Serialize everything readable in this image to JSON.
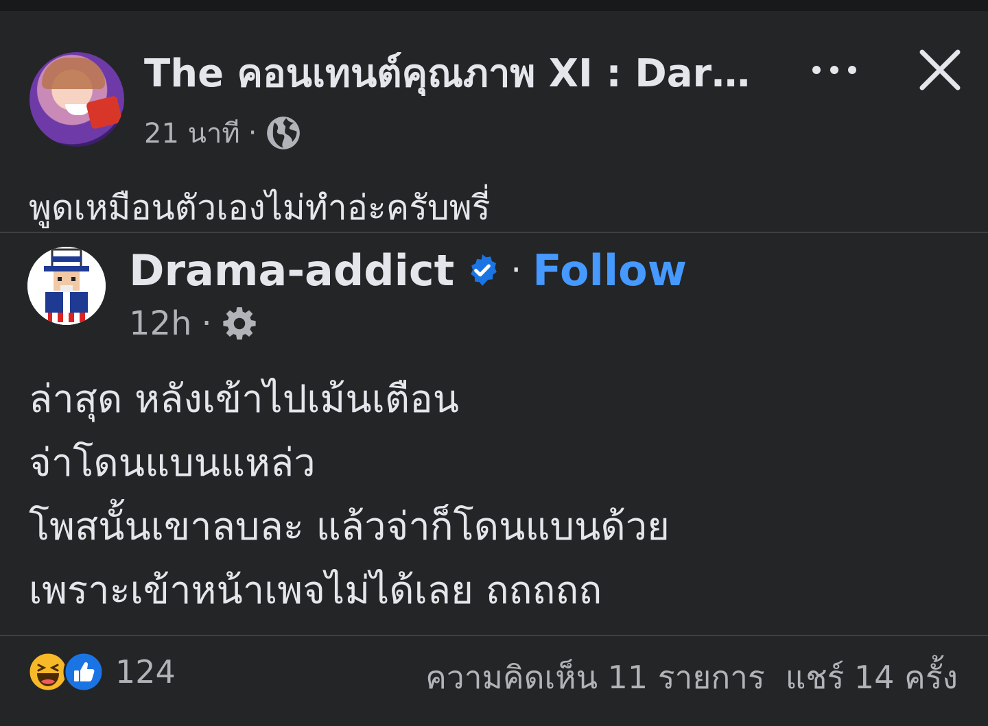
{
  "post": {
    "title": "The คอนเทนต์คุณภาพ XI : Dark ...",
    "time": "21 นาที",
    "separator": "·",
    "caption": "พูดเหมือนตัวเองไม่ทำอ่ะครับพรี่"
  },
  "shared": {
    "name": "Drama-addict",
    "separator": "·",
    "follow_label": "Follow",
    "time": "12h",
    "time_separator": "·",
    "lines": [
      "ล่าสุด หลังเข้าไปเม้นเตือน",
      "จ่าโดนแบนแหล่ว",
      "โพสนั้นเขาลบละ แล้วจ่าก็โดนแบนด้วย",
      "เพราะเข้าหน้าเพจไม่ได้เลย ถถถถถ"
    ]
  },
  "footer": {
    "reaction_count": "124",
    "comments": "ความคิดเห็น 11 รายการ",
    "shares": "แชร์ 14 ครั้ง"
  },
  "icons": {
    "more": "more-horizontal-icon",
    "close": "close-icon",
    "privacy": "globe-icon",
    "shared_privacy": "gear-icon",
    "verified": "verified-badge-icon",
    "reaction_1": "haha-reaction-icon",
    "reaction_2": "like-reaction-icon"
  },
  "colors": {
    "background": "#242526",
    "text": "#e4e6eb",
    "secondary_text": "#b0b3b8",
    "link": "#4599ff",
    "verified": "#1b74e4",
    "like": "#1b74e4",
    "haha": "#f7b928"
  }
}
